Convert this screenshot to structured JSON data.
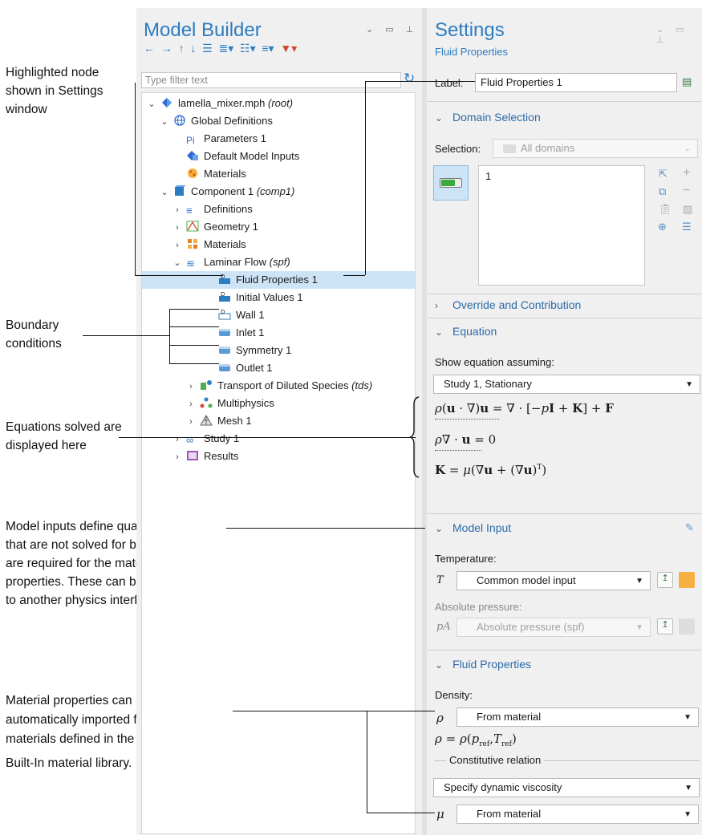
{
  "annotations": {
    "highlighted": [
      "Highlighted node",
      "shown in Settings",
      "window"
    ],
    "boundary": [
      "Boundary",
      "conditions"
    ],
    "equations": [
      "Equations solved are",
      "displayed here"
    ],
    "model_inputs": [
      "Model inputs define quantities",
      "that are not solved for but that",
      "are required for the material",
      "properties. These can be linked",
      "to another physics interface."
    ],
    "material_props": [
      "Material properties can be",
      "automatically imported from",
      "materials defined in the",
      "Built-In material library."
    ]
  },
  "model_builder": {
    "title": "Model Builder",
    "filter_placeholder": "Type filter text",
    "tree": [
      {
        "label": "lamella_mixer.mph",
        "suffix": "(root)",
        "icon": "mph-file-icon"
      },
      {
        "label": "Global Definitions",
        "icon": "global-icon"
      },
      {
        "label": "Parameters 1",
        "icon": "parameters-icon",
        "glyph": "Pi"
      },
      {
        "label": "Default Model Inputs",
        "icon": "model-inputs-icon"
      },
      {
        "label": "Materials",
        "icon": "materials-icon"
      },
      {
        "label": "Component 1",
        "suffix": "(comp1)",
        "icon": "component-icon"
      },
      {
        "label": "Definitions",
        "icon": "definitions-icon"
      },
      {
        "label": "Geometry 1",
        "icon": "geometry-icon"
      },
      {
        "label": "Materials",
        "icon": "materials-icon"
      },
      {
        "label": "Laminar Flow",
        "suffix": "(spf)",
        "icon": "laminar-flow-icon"
      },
      {
        "label": "Fluid Properties 1",
        "icon": "domain-node-icon",
        "glyph": "D"
      },
      {
        "label": "Initial Values 1",
        "icon": "domain-node-icon",
        "glyph": "D"
      },
      {
        "label": "Wall 1",
        "icon": "boundary-node-icon",
        "glyph": "D"
      },
      {
        "label": "Inlet 1",
        "icon": "boundary-node-icon"
      },
      {
        "label": "Symmetry 1",
        "icon": "boundary-node-icon"
      },
      {
        "label": "Outlet 1",
        "icon": "boundary-node-icon"
      },
      {
        "label": "Transport of Diluted Species",
        "suffix": "(tds)",
        "icon": "tds-icon"
      },
      {
        "label": "Multiphysics",
        "icon": "multiphysics-icon"
      },
      {
        "label": "Mesh 1",
        "icon": "mesh-icon"
      },
      {
        "label": "Study 1",
        "icon": "study-icon"
      },
      {
        "label": "Results",
        "icon": "results-icon"
      }
    ]
  },
  "settings": {
    "title": "Settings",
    "subtitle": "Fluid Properties",
    "label_caption": "Label:",
    "label_value": "Fluid Properties 1",
    "domain_selection": "Domain Selection",
    "selection_caption": "Selection:",
    "selection_value": "All domains",
    "selection_list": [
      "1"
    ],
    "override": "Override and Contribution",
    "equation": "Equation",
    "show_eq": "Show equation assuming:",
    "study_value": "Study 1, Stationary",
    "model_input": "Model Input",
    "temperature": "Temperature:",
    "T_symbol": "T",
    "temp_value": "Common model input",
    "abs_pressure": "Absolute pressure:",
    "pA_symbol": "pA",
    "pressure_value": "Absolute pressure (spf)",
    "fluid_properties": "Fluid Properties",
    "density": "Density:",
    "rho_symbol": "ρ",
    "density_value": "From material",
    "constitutive": "Constitutive relation",
    "constitutive_value": "Specify dynamic viscosity",
    "mu_symbol": "μ",
    "viscosity_value": "From material"
  }
}
